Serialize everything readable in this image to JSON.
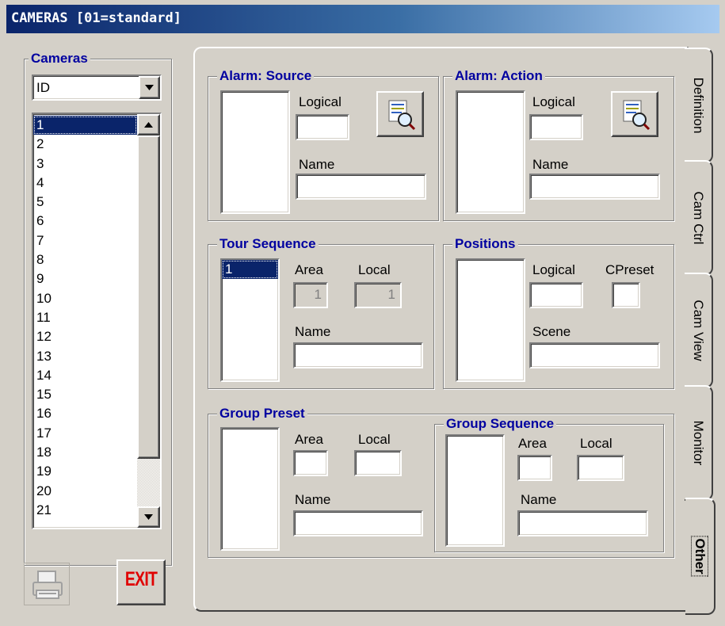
{
  "window": {
    "title": "CAMERAS [01=standard]"
  },
  "cameras": {
    "label": "Cameras",
    "sort_by": "ID",
    "items": [
      "1",
      "2",
      "3",
      "4",
      "5",
      "6",
      "7",
      "8",
      "9",
      "10",
      "11",
      "12",
      "13",
      "14",
      "15",
      "16",
      "17",
      "18",
      "19",
      "20",
      "21"
    ],
    "selected": "1"
  },
  "buttons": {
    "exit_label": "EXIT",
    "print_icon": "printer-icon"
  },
  "tabs": [
    {
      "label": "Definition",
      "active": false
    },
    {
      "label": "Cam Ctrl",
      "active": false
    },
    {
      "label": "Cam View",
      "active": false
    },
    {
      "label": "Monitor",
      "active": false
    },
    {
      "label": "Other",
      "active": true
    }
  ],
  "alarm_source": {
    "title": "Alarm: Source",
    "logical_label": "Logical",
    "name_label": "Name",
    "logical_value": "",
    "name_value": ""
  },
  "alarm_action": {
    "title": "Alarm: Action",
    "logical_label": "Logical",
    "name_label": "Name",
    "logical_value": "",
    "name_value": ""
  },
  "tour_sequence": {
    "title": "Tour Sequence",
    "items": [
      "1"
    ],
    "area_label": "Area",
    "local_label": "Local",
    "area_value": "1",
    "local_value": "1",
    "name_label": "Name",
    "name_value": ""
  },
  "positions": {
    "title": "Positions",
    "logical_label": "Logical",
    "cpreset_label": "CPreset",
    "scene_label": "Scene",
    "logical_value": "",
    "cpreset_value": "",
    "scene_value": ""
  },
  "group_preset": {
    "title": "Group Preset",
    "area_label": "Area",
    "local_label": "Local",
    "name_label": "Name",
    "area_value": "",
    "local_value": "",
    "name_value": ""
  },
  "group_sequence": {
    "title": "Group Sequence",
    "area_label": "Area",
    "local_label": "Local",
    "name_label": "Name",
    "area_value": "",
    "local_value": "",
    "name_value": ""
  },
  "colors": {
    "title_start": "#0a246a",
    "title_end": "#a6caf0",
    "face": "#d4d0c8",
    "legend": "#0000a0",
    "selection": "#0a246a",
    "exit_red": "#e00000"
  }
}
